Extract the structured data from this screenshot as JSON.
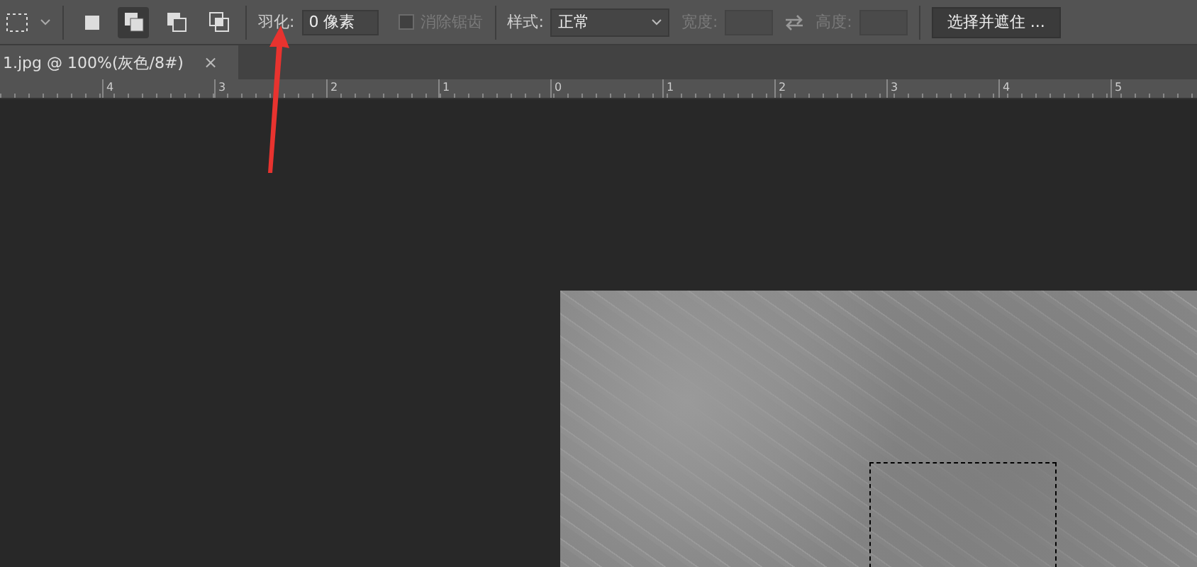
{
  "toolbar": {
    "modes": [
      {
        "selected": false
      },
      {
        "selected": true
      },
      {
        "selected": false
      },
      {
        "selected": false
      }
    ],
    "feather": {
      "label": "羽化:",
      "value": "0 像素"
    },
    "anti_alias": {
      "label": "消除锯齿",
      "checked": false,
      "disabled": true
    },
    "style": {
      "label": "样式:",
      "value": "正常"
    },
    "width": {
      "label": "宽度:",
      "disabled": true
    },
    "height": {
      "label": "高度:",
      "disabled": true
    },
    "refine_button": "选择并遮住 ..."
  },
  "document_tab": {
    "title": "1.jpg @ 100%(灰色/8#)",
    "close": "×"
  },
  "ruler": {
    "labels": [
      "4",
      "3",
      "2",
      "1",
      "0",
      "1",
      "2",
      "3",
      "4",
      "5"
    ]
  }
}
